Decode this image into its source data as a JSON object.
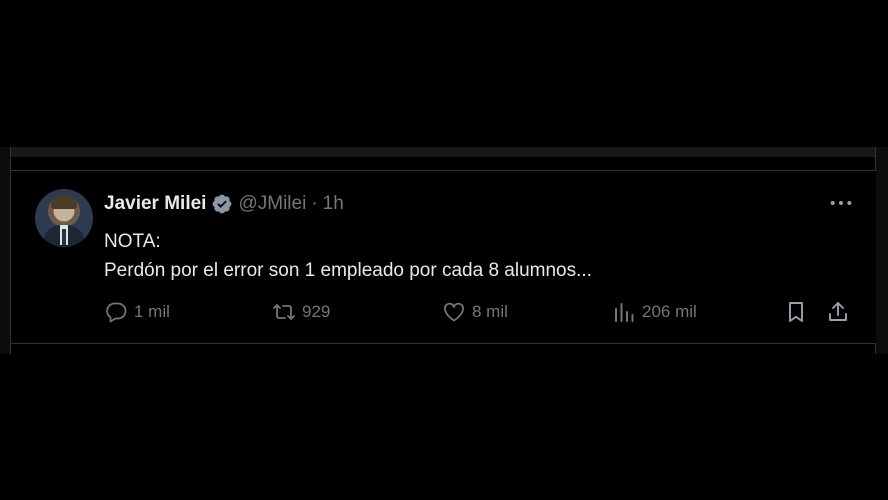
{
  "tweet": {
    "author_name": "Javier Milei",
    "handle": "@JMilei",
    "separator": "·",
    "time": "1h",
    "lines": [
      "NOTA:",
      "Perdón por el error son 1 empleado por cada 8 alumnos..."
    ],
    "stats": {
      "replies": "1 mil",
      "retweets": "929",
      "likes": "8 mil",
      "views": "206 mil"
    }
  },
  "colors": {
    "background": "#000000",
    "text_primary": "#e7e9ea",
    "text_secondary": "#71767b",
    "divider": "#2f3336",
    "verified_badge": "#8b98a5"
  },
  "icons": {
    "verified": "verified-badge-icon",
    "more": "more-icon",
    "reply": "reply-icon",
    "retweet": "retweet-icon",
    "like": "heart-icon",
    "views": "views-icon",
    "bookmark": "bookmark-icon",
    "share": "share-icon"
  }
}
